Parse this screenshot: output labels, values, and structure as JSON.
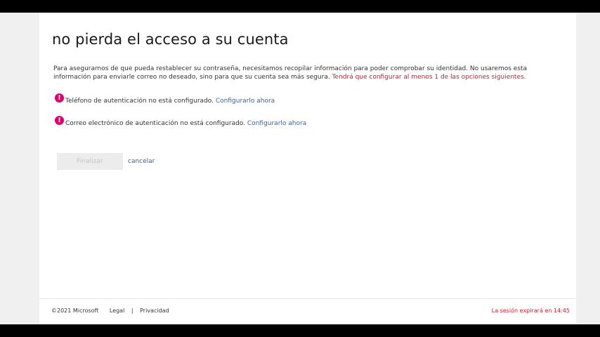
{
  "page": {
    "title": "no pierda el acceso a su cuenta",
    "intro_text": "Para asegurarnos de que pueda restablecer su contraseña, necesitamos recopilar información para poder comprobar su identidad. No usaremos esta información para enviarle correo no deseado, sino para que su cuenta sea más segura.",
    "intro_warning": "Tendrá que configurar al menos 1 de las opciones siguientes."
  },
  "requirements": [
    {
      "icon": "alert-icon",
      "icon_glyph": "!",
      "text": "Teléfono de autenticación no está configurado.",
      "link": "Configurarlo ahora"
    },
    {
      "icon": "alert-icon",
      "icon_glyph": "!",
      "text": "Correo electrónico de autenticación no está configurado.",
      "link": "Configurarlo ahora"
    }
  ],
  "actions": {
    "finish_label": "Finalizar",
    "finish_enabled": false,
    "cancel_label": "cancelar"
  },
  "footer": {
    "copyright": "©2021 Microsoft",
    "legal": "Legal",
    "separator": "|",
    "privacy": "Privacidad",
    "session_text": "La sesión expirará en 14:45"
  },
  "colors": {
    "link": "#2b63b8",
    "warning": "#e81123",
    "alert_icon": "#e3006c"
  }
}
